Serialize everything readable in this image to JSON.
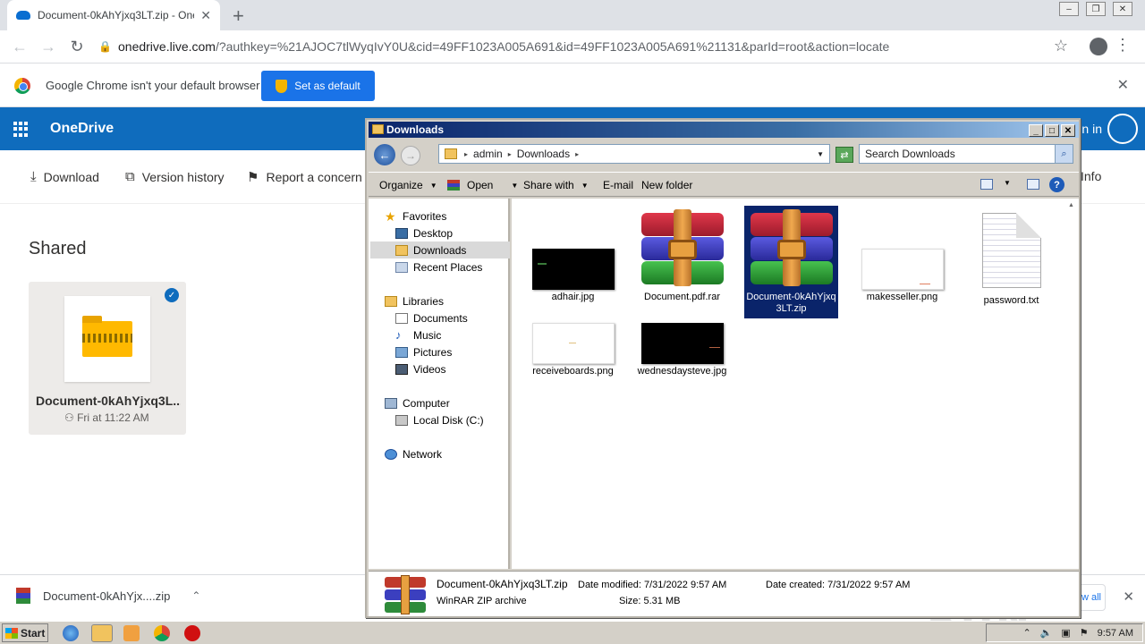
{
  "browser": {
    "tab_title": "Document-0kAhYjxq3LT.zip - OneDrive",
    "url_domain": "onedrive.live.com",
    "url_path": "/?authkey=%21AJOC7tlWyqIvY0U&cid=49FF1023A005A691&id=49FF1023A005A691%21131&parId=root&action=locate",
    "infobar_text": "Google Chrome isn't your default browser",
    "set_default_label": "Set as default"
  },
  "onedrive": {
    "app_title": "OneDrive",
    "sign_in": "n in",
    "commands": [
      "Download",
      "Version history",
      "Report a concern"
    ],
    "info_label": "Info",
    "section_title": "Shared",
    "file_card": {
      "name": "Document-0kAhYjxq3L...",
      "date": "Fri at 11:22 AM"
    }
  },
  "download_shelf": {
    "file_label": "Document-0kAhYjx....zip",
    "show_all": "w all"
  },
  "explorer": {
    "title": "Downloads",
    "breadcrumb": [
      "admin",
      "Downloads"
    ],
    "search_placeholder": "Search Downloads",
    "commands": {
      "organize": "Organize",
      "open": "Open",
      "share_with": "Share with",
      "email": "E-mail",
      "new_folder": "New folder"
    },
    "nav": {
      "favorites": "Favorites",
      "desktop": "Desktop",
      "downloads": "Downloads",
      "recent": "Recent Places",
      "libraries": "Libraries",
      "documents": "Documents",
      "music": "Music",
      "pictures": "Pictures",
      "videos": "Videos",
      "computer": "Computer",
      "local_disk": "Local Disk (C:)",
      "network": "Network"
    },
    "files": [
      {
        "name": "adhair.jpg"
      },
      {
        "name": "Document.pdf.rar"
      },
      {
        "name": "Document-0kAhYjxq3LT.zip"
      },
      {
        "name": "makesseller.png"
      },
      {
        "name": "password.txt"
      },
      {
        "name": "receiveboards.png"
      },
      {
        "name": "wednesdaysteve.jpg"
      }
    ],
    "details": {
      "name": "Document-0kAhYjxq3LT.zip",
      "type": "WinRAR ZIP archive",
      "modified": "Date modified: 7/31/2022 9:57 AM",
      "size": "Size: 5.31 MB",
      "created": "Date created: 7/31/2022 9:57 AM"
    }
  },
  "taskbar": {
    "start": "Start",
    "clock": "9:57 AM"
  },
  "watermark": "ANY RUN"
}
